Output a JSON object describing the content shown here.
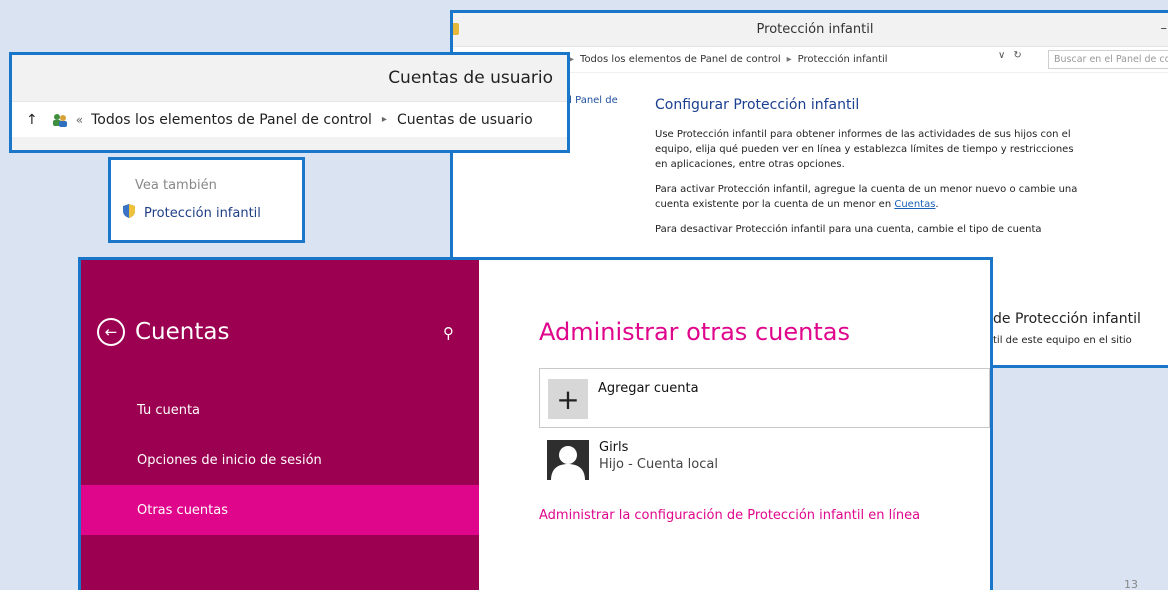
{
  "proteccion_window": {
    "title": "Protección infantil",
    "minimize_glyph": "–",
    "breadcrumb": [
      "Todos los elementos de Panel de control",
      "Protección infantil"
    ],
    "breadcrumb_sep": "▸",
    "dropdown_glyph": "∨",
    "refresh_glyph": "↻",
    "search_placeholder": "Buscar en el Panel de control",
    "left_link": "el Panel de",
    "heading": "Configurar Protección infantil",
    "para1": "Use Protección infantil para obtener informes de las actividades de sus hijos con el equipo, elija qué pueden ver en línea y establezca límites de tiempo y restricciones en aplicaciones, entre otras opciones.",
    "para2_before": "Para activar Protección infantil, agregue la cuenta de un menor nuevo o cambie una cuenta existente por la cuenta de un menor en ",
    "para2_link": "Cuentas",
    "para2_after": ".",
    "para3": "Para desactivar Protección infantil para una cuenta, cambie el tipo de cuenta",
    "lower_title": "de Protección infantil",
    "lower_text": "til de este equipo en el sitio"
  },
  "cuentas_usuario_window": {
    "title": "Cuentas de usuario",
    "up_glyph": "↑",
    "chevrons": "«",
    "breadcrumb": [
      "Todos los elementos de Panel de control",
      "Cuentas de usuario"
    ],
    "breadcrumb_sep": "▸"
  },
  "vea_tambien": {
    "caption": "Vea también",
    "link": "Protección infantil"
  },
  "cuentas_settings": {
    "header": "Cuentas",
    "back_glyph": "←",
    "search_glyph": "⚲",
    "nav": [
      "Tu cuenta",
      "Opciones de inicio de sesión",
      "Otras cuentas"
    ],
    "active_nav": "Otras cuentas",
    "title": "Administrar otras cuentas",
    "add_glyph": "+",
    "add_label": "Agregar cuenta",
    "user_name": "Girls",
    "user_sub": "Hijo - Cuenta local",
    "online_link": "Administrar la configuración de Protección infantil en línea",
    "accent": "#e0068c",
    "sidebar_color": "#9c0050"
  },
  "page_number": "13"
}
